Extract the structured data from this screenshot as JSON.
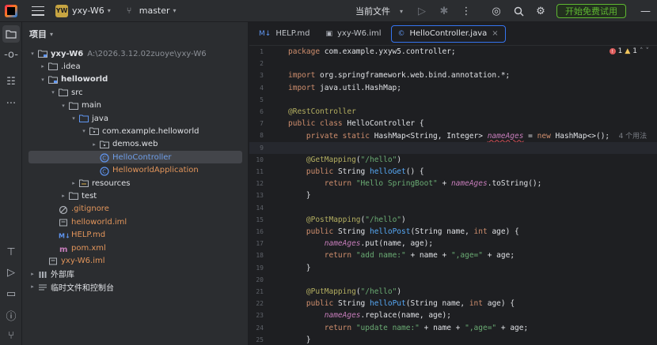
{
  "titlebar": {
    "project_badge": "YW",
    "project_name": "yxy-W6",
    "branch": "master",
    "run_config": "当前文件",
    "trial_button": "开始免费试用"
  },
  "project_panel": {
    "header": "项目",
    "tree": [
      {
        "arrow": "▾",
        "icon": "module-folder-icon",
        "label": "yxy-W6",
        "extra": "A:\\2026.3.12.02zuoye\\yxy-W6",
        "indent": 0,
        "style": "bold"
      },
      {
        "arrow": "▸",
        "icon": "folder-icon",
        "label": ".idea",
        "extra": "",
        "indent": 1,
        "style": ""
      },
      {
        "arrow": "▾",
        "icon": "module-folder-icon",
        "label": "helloworld",
        "extra": "",
        "indent": 1,
        "style": "bold"
      },
      {
        "arrow": "▾",
        "icon": "folder-icon",
        "label": "src",
        "extra": "",
        "indent": 2,
        "style": ""
      },
      {
        "arrow": "▾",
        "icon": "folder-icon",
        "label": "main",
        "extra": "",
        "indent": 3,
        "style": ""
      },
      {
        "arrow": "▾",
        "icon": "source-folder-icon",
        "label": "java",
        "extra": "",
        "indent": 4,
        "style": ""
      },
      {
        "arrow": "▾",
        "icon": "package-icon",
        "label": "com.example.helloworld",
        "extra": "",
        "indent": 5,
        "style": ""
      },
      {
        "arrow": "▸",
        "icon": "package-icon",
        "label": "demos.web",
        "extra": "",
        "indent": 6,
        "style": ""
      },
      {
        "arrow": "",
        "icon": "class-icon",
        "label": "HelloController",
        "extra": "",
        "indent": 6,
        "style": "orange",
        "selected": true
      },
      {
        "arrow": "",
        "icon": "spring-class-icon",
        "label": "HelloworldApplication",
        "extra": "",
        "indent": 6,
        "style": "orange"
      },
      {
        "arrow": "▸",
        "icon": "resources-folder-icon",
        "label": "resources",
        "extra": "",
        "indent": 4,
        "style": ""
      },
      {
        "arrow": "▸",
        "icon": "folder-icon",
        "label": "test",
        "extra": "",
        "indent": 3,
        "style": ""
      },
      {
        "arrow": "",
        "icon": "gitignore-icon",
        "label": ".gitignore",
        "extra": "",
        "indent": 2,
        "style": "orange"
      },
      {
        "arrow": "",
        "icon": "iml-file-icon",
        "label": "helloworld.iml",
        "extra": "",
        "indent": 2,
        "style": "orange"
      },
      {
        "arrow": "",
        "icon": "markdown-icon",
        "label": "HELP.md",
        "extra": "",
        "indent": 2,
        "style": "orange"
      },
      {
        "arrow": "",
        "icon": "maven-icon",
        "label": "pom.xml",
        "extra": "",
        "indent": 2,
        "style": "orange"
      },
      {
        "arrow": "",
        "icon": "iml-file-icon",
        "label": "yxy-W6.iml",
        "extra": "",
        "indent": 1,
        "style": "orange"
      },
      {
        "arrow": "▸",
        "icon": "library-icon",
        "label": "外部库",
        "extra": "",
        "indent": 0,
        "style": ""
      },
      {
        "arrow": "▸",
        "icon": "scratches-icon",
        "label": "临时文件和控制台",
        "extra": "",
        "indent": 0,
        "style": ""
      }
    ]
  },
  "editor": {
    "tabs": [
      {
        "icon": "M↓",
        "label": "HELP.md",
        "active": false
      },
      {
        "icon": "▣",
        "label": "yxy-W6.iml",
        "active": false
      },
      {
        "icon": "©",
        "label": "HelloController.java",
        "active": true
      }
    ],
    "inspections": {
      "errors": "1",
      "warnings": "1"
    },
    "lines": [
      {
        "n": "1",
        "html": "<span class='kw'>package</span> com.example.yxyw5.controller;"
      },
      {
        "n": "2",
        "html": ""
      },
      {
        "n": "3",
        "html": "<span class='kw'>import</span> org.springframework.web.bind.annotation.*;"
      },
      {
        "n": "4",
        "html": "<span class='kw'>import</span> java.util.HashMap;"
      },
      {
        "n": "5",
        "html": ""
      },
      {
        "n": "6",
        "html": "<span class='ann'>@RestController</span>"
      },
      {
        "n": "7",
        "html": "<span class='kw'>public class</span> HelloController {"
      },
      {
        "n": "8",
        "html": "    <span class='kw'>private static</span> HashMap&lt;String, Integer&gt; <span class='fld wavy'>nameAges</span> = <span class='kw'>new</span> HashMap&lt;&gt;();  <span class='hint'>4 个用法</span>"
      },
      {
        "n": "9",
        "html": "",
        "current": true
      },
      {
        "n": "10",
        "html": "    <span class='ann'>@GetMapping</span>(<span class='str'>\"/hello\"</span>)"
      },
      {
        "n": "11",
        "html": "    <span class='kw'>public</span> String <span class='fn'>helloGet</span>() {"
      },
      {
        "n": "12",
        "html": "        <span class='kw'>return</span> <span class='str'>\"Hello SpringBoot\"</span> + <span class='fld'>nameAges</span>.toString();"
      },
      {
        "n": "13",
        "html": "    }"
      },
      {
        "n": "14",
        "html": ""
      },
      {
        "n": "15",
        "html": "    <span class='ann'>@PostMapping</span>(<span class='str'>\"/hello\"</span>)"
      },
      {
        "n": "16",
        "html": "    <span class='kw'>public</span> String <span class='fn'>helloPost</span>(String name, <span class='kw'>int</span> age) {"
      },
      {
        "n": "17",
        "html": "        <span class='fld'>nameAges</span>.put(name, age);"
      },
      {
        "n": "18",
        "html": "        <span class='kw'>return</span> <span class='str'>\"add name:\"</span> + name + <span class='str'>\",age=\"</span> + age;"
      },
      {
        "n": "19",
        "html": "    }"
      },
      {
        "n": "20",
        "html": ""
      },
      {
        "n": "21",
        "html": "    <span class='ann'>@PutMapping</span>(<span class='str'>\"/hello\"</span>)"
      },
      {
        "n": "22",
        "html": "    <span class='kw'>public</span> String <span class='fn'>helloPut</span>(String name, <span class='kw'>int</span> age) {"
      },
      {
        "n": "23",
        "html": "        <span class='fld'>nameAges</span>.replace(name, age);"
      },
      {
        "n": "24",
        "html": "        <span class='kw'>return</span> <span class='str'>\"update name:\"</span> + name + <span class='str'>\",age=\"</span> + age;"
      },
      {
        "n": "25",
        "html": "    }"
      }
    ]
  }
}
